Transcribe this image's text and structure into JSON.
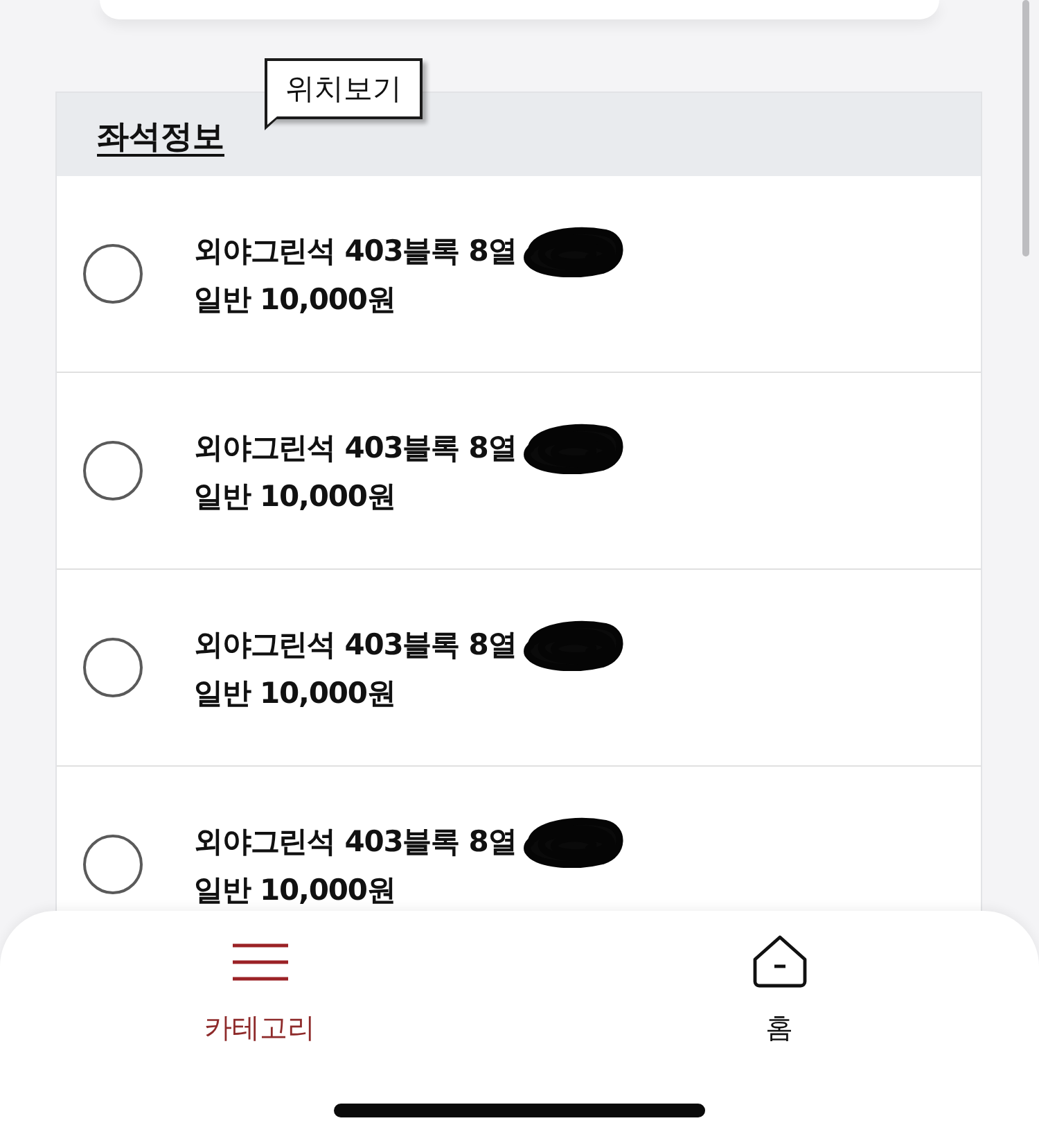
{
  "tooltip": {
    "label": "위치보기"
  },
  "section": {
    "title": "좌석정보"
  },
  "seats": [
    {
      "seat": "외야그린석 403블록 8열",
      "price": "일반 10,000원",
      "selected": false,
      "redacted": true
    },
    {
      "seat": "외야그린석 403블록 8열",
      "price": "일반 10,000원",
      "selected": false,
      "redacted": true
    },
    {
      "seat": "외야그린석 403블록 8열",
      "price": "일반 10,000원",
      "selected": false,
      "redacted": true
    },
    {
      "seat": "외야그린석 403블록 8열",
      "price": "일반 10,000원",
      "selected": false,
      "redacted": true
    }
  ],
  "bottom_nav": [
    {
      "label": "카테고리",
      "kind": "menu",
      "selected": true
    },
    {
      "label": "홈",
      "kind": "home",
      "selected": false
    }
  ]
}
